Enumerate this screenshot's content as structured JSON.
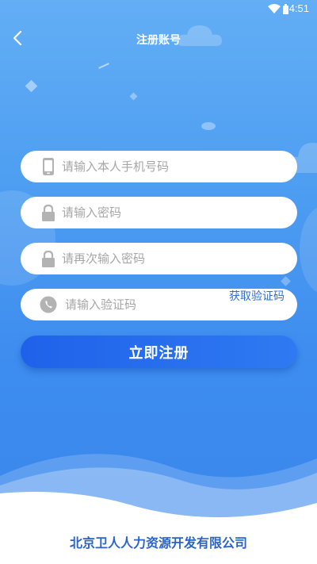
{
  "status_bar": {
    "time": "4:51"
  },
  "nav": {
    "title": "注册账号"
  },
  "form": {
    "phone_placeholder": "请输入本人手机号码",
    "password_placeholder": "请输入密码",
    "confirm_password_placeholder": "请再次输入密码",
    "code_placeholder": "请输入验证码",
    "get_code_label": "获取验证码",
    "submit_label": "立即注册"
  },
  "footer": {
    "company_name": "北京卫人人力资源开发有限公司"
  },
  "colors": {
    "primary": "#2f7af2",
    "link": "#2d6fd6",
    "background_top": "#63aef5",
    "company_text": "#2a64c9"
  },
  "icons": [
    "back-arrow-icon",
    "phone-icon",
    "lock-icon",
    "lock-icon",
    "wechat-icon",
    "wifi-icon",
    "battery-icon"
  ]
}
